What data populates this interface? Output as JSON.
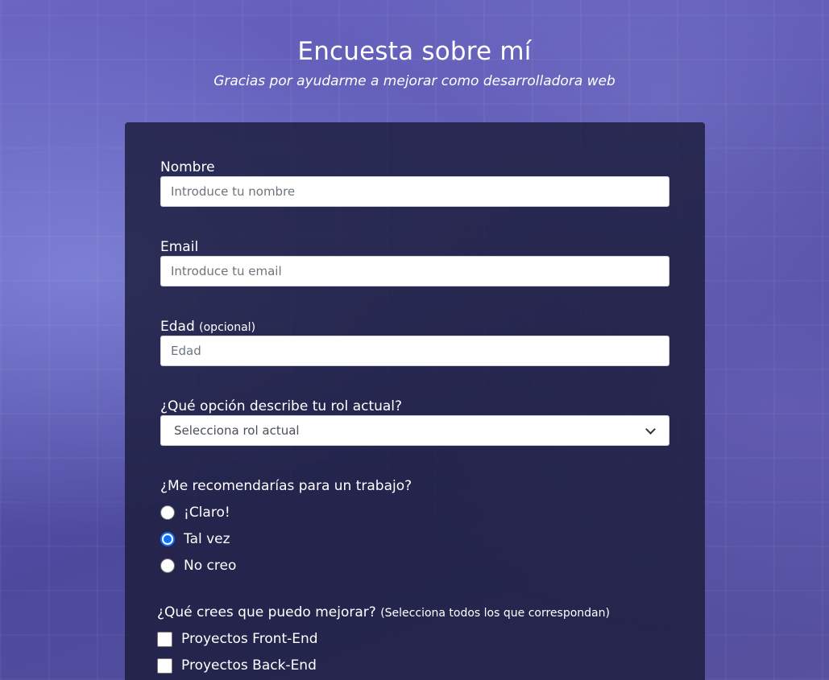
{
  "header": {
    "title": "Encuesta sobre mí",
    "description": "Gracias por ayudarme a mejorar como desarrolladora web"
  },
  "form": {
    "name": {
      "label": "Nombre",
      "placeholder": "Introduce tu nombre"
    },
    "email": {
      "label": "Email",
      "placeholder": "Introduce tu email"
    },
    "age": {
      "label": "Edad",
      "clue": "(opcional)",
      "placeholder": "Edad"
    },
    "role": {
      "label": "¿Qué opción describe tu rol actual?",
      "selected": "Selecciona rol actual"
    },
    "recommend": {
      "label": "¿Me recomendarías para un trabajo?",
      "options": [
        "¡Claro!",
        "Tal vez",
        "No creo"
      ],
      "selected": "Tal vez"
    },
    "improve": {
      "label": "¿Qué crees que puedo mejorar?",
      "clue": "(Selecciona todos los que correspondan)",
      "options": [
        "Proyectos Front-End",
        "Proyectos Back-End"
      ]
    }
  },
  "colors": {
    "radio_checked": "#0d6efd",
    "card_background": "#1b1c3a"
  }
}
